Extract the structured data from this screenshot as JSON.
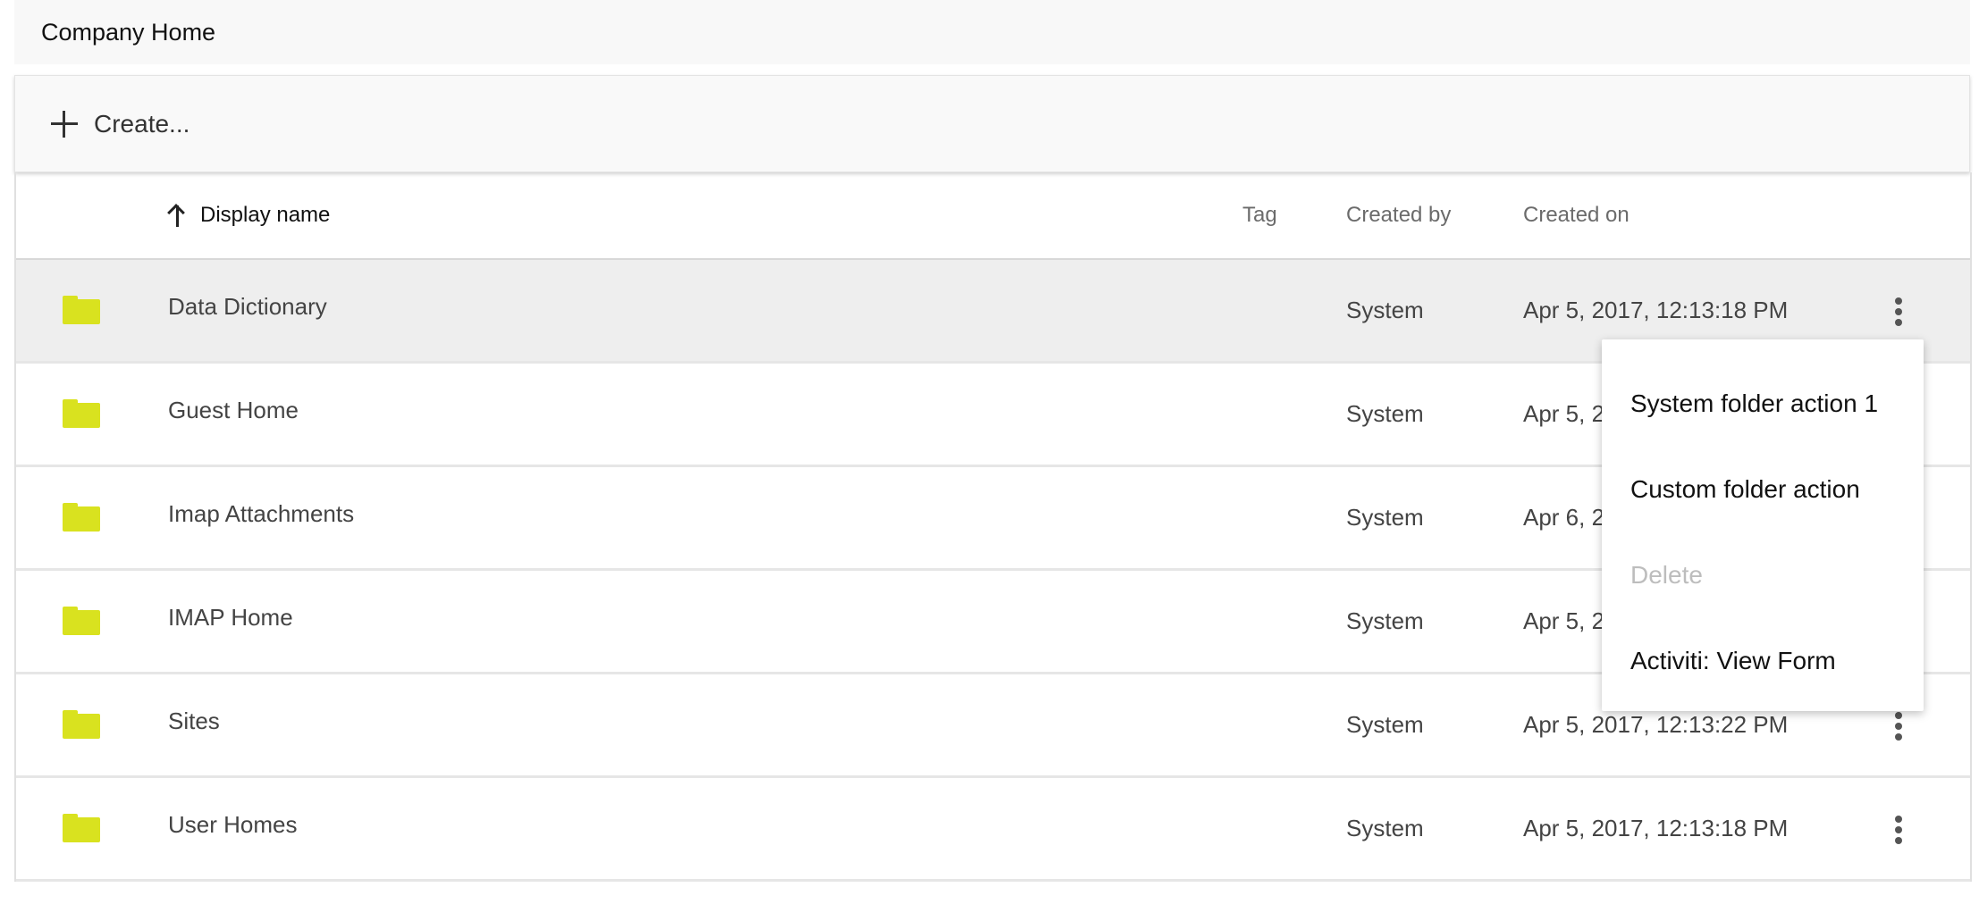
{
  "breadcrumb": {
    "current": "Company Home"
  },
  "toolbar": {
    "create_label": "Create...",
    "create_icon": "plus-icon"
  },
  "table": {
    "columns": {
      "name": "Display name",
      "tag": "Tag",
      "created_by": "Created by",
      "created_on": "Created on"
    },
    "sort": {
      "column": "name",
      "direction": "ascending",
      "icon": "arrow-up-icon"
    },
    "rows": [
      {
        "name": "Data Dictionary",
        "created_by": "System",
        "created_on": "Apr 5, 2017, 12:13:18 PM",
        "selected": true
      },
      {
        "name": "Guest Home",
        "created_by": "System",
        "created_on": "Apr 5, 2"
      },
      {
        "name": "Imap Attachments",
        "created_by": "System",
        "created_on": "Apr 6, 2"
      },
      {
        "name": "IMAP Home",
        "created_by": "System",
        "created_on": "Apr 5, 2"
      },
      {
        "name": "Sites",
        "created_by": "System",
        "created_on": "Apr 5, 2017, 12:13:22 PM"
      },
      {
        "name": "User Homes",
        "created_by": "System",
        "created_on": "Apr 5, 2017, 12:13:18 PM"
      }
    ]
  },
  "context_menu": {
    "items": [
      {
        "label": "System folder action 1",
        "disabled": false
      },
      {
        "label": "Custom folder action",
        "disabled": false
      },
      {
        "label": "Delete",
        "disabled": true
      },
      {
        "label": "Activiti: View Form",
        "disabled": false
      }
    ]
  },
  "colors": {
    "folder": "#d9e21f",
    "selected_row": "#eeeeee",
    "disabled_text": "#bdbdbd"
  }
}
